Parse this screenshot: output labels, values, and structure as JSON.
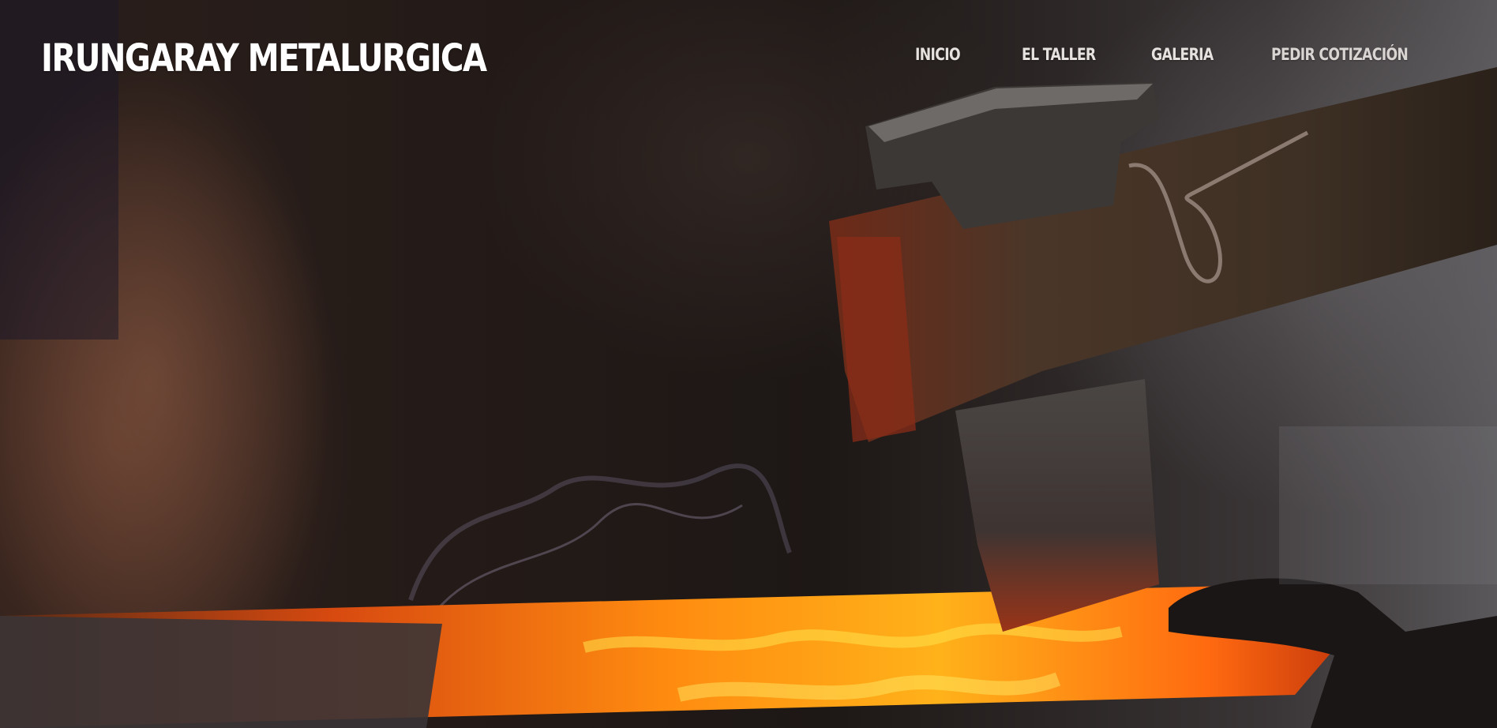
{
  "header": {
    "brand": "IRUNGARAY METALURGICA"
  },
  "nav": {
    "items": [
      {
        "label": "INICIO"
      },
      {
        "label": "EL TALLER"
      },
      {
        "label": "GALERIA"
      },
      {
        "label": "PEDIR COTIZACIÓN"
      }
    ]
  },
  "hero": {
    "image": "blacksmith-axe-on-glowing-metal"
  }
}
